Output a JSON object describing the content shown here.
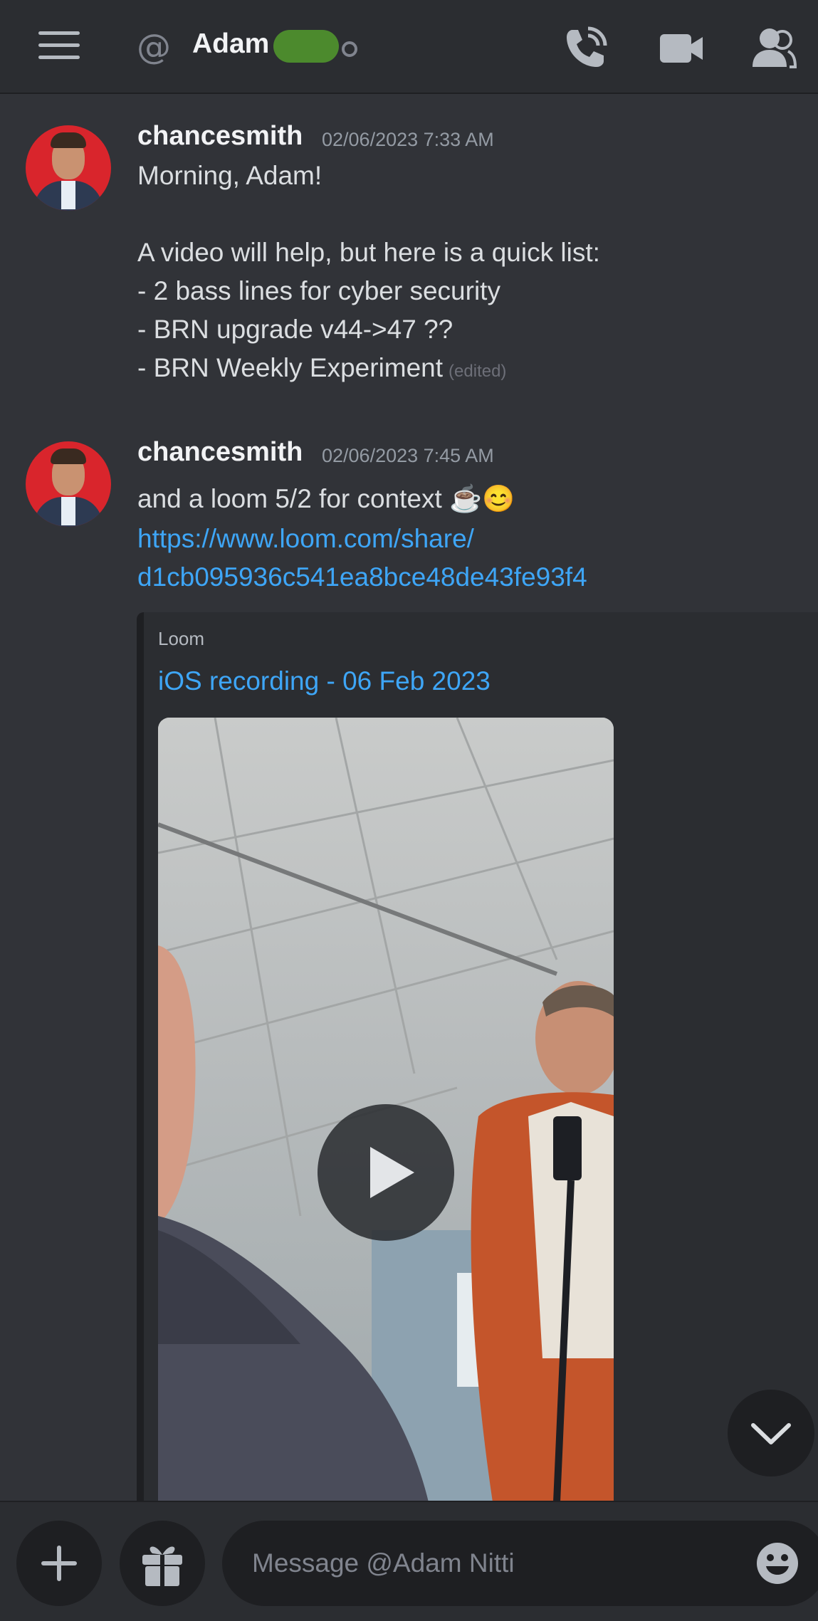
{
  "header": {
    "title": "Adam",
    "icons": [
      "hamburger-icon",
      "at-icon",
      "phone-icon",
      "video-icon",
      "members-icon"
    ]
  },
  "messages": [
    {
      "author": "chancesmith",
      "timestamp": "02/06/2023 7:33 AM",
      "lines": [
        "Morning, Adam!",
        "",
        "A video will help, but here is a quick list:",
        "- 2 bass lines for cyber security",
        "- BRN upgrade v44->47 ??",
        "- BRN Weekly Experiment"
      ],
      "edited": "(edited)"
    },
    {
      "author": "chancesmith",
      "timestamp": "02/06/2023 7:45 AM",
      "text": "and a loom 5/2 for context ☕😊",
      "link_line1": "https://www.loom.com/share/",
      "link_line2": "d1cb095936c541ea8bce48de43fe93f4",
      "embed": {
        "provider": "Loom",
        "title": "iOS recording - 06 Feb 2023"
      }
    }
  ],
  "composer": {
    "placeholder": "Message @Adam Nitti"
  },
  "colors": {
    "background": "#313338",
    "header": "#2b2d31",
    "link": "#3ea6f7",
    "avatar": "#d9252c"
  }
}
